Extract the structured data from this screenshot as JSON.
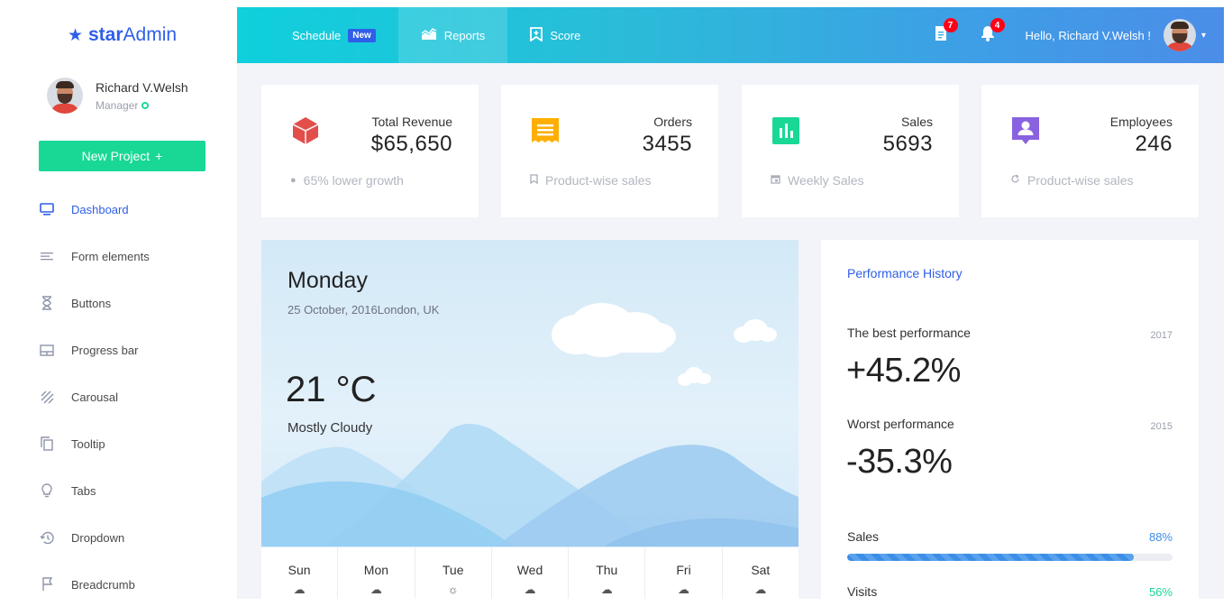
{
  "brand": {
    "prefix": "star",
    "suffix": "Admin"
  },
  "user": {
    "name": "Richard V.Welsh",
    "role": "Manager",
    "greeting": "Hello, Richard V.Welsh !"
  },
  "sidebar": {
    "new_project": "New Project",
    "items": [
      {
        "label": "Dashboard",
        "icon": "monitor-icon",
        "active": true
      },
      {
        "label": "Form elements",
        "icon": "lines-icon"
      },
      {
        "label": "Buttons",
        "icon": "hourglass-icon"
      },
      {
        "label": "Progress bar",
        "icon": "layout-icon"
      },
      {
        "label": "Carousal",
        "icon": "stripes-icon"
      },
      {
        "label": "Tooltip",
        "icon": "copy-icon"
      },
      {
        "label": "Tabs",
        "icon": "lightbulb-icon"
      },
      {
        "label": "Dropdown",
        "icon": "history-icon"
      },
      {
        "label": "Breadcrumb",
        "icon": "flag-icon"
      }
    ]
  },
  "topnav": {
    "items": [
      {
        "label": "Schedule",
        "badge": "New",
        "icon": ""
      },
      {
        "label": "Reports",
        "icon": "chart-icon"
      },
      {
        "label": "Score",
        "icon": "bookmark-icon"
      }
    ],
    "notifications": {
      "messages": "7",
      "alerts": "4"
    }
  },
  "stats": [
    {
      "label": "Total Revenue",
      "value": "$65,650",
      "foot": "65% lower growth",
      "color": "#e24f4b",
      "icon": "cube-icon",
      "foot_icon": "info-icon"
    },
    {
      "label": "Orders",
      "value": "3455",
      "foot": "Product-wise sales",
      "color": "#ffaf00",
      "icon": "receipt-icon",
      "foot_icon": "bookmark-icon"
    },
    {
      "label": "Sales",
      "value": "5693",
      "foot": "Weekly Sales",
      "color": "#19d895",
      "icon": "bar-chart-icon",
      "foot_icon": "calendar-icon"
    },
    {
      "label": "Employees",
      "value": "246",
      "foot": "Product-wise sales",
      "color": "#8862e0",
      "icon": "account-box-icon",
      "foot_icon": "reload-icon"
    }
  ],
  "weather": {
    "day": "Monday",
    "date": "25 October, 2016",
    "location": "London, UK",
    "temperature": "21 °C",
    "condition": "Mostly Cloudy",
    "forecast": [
      {
        "day": "Sun",
        "icon": "cloud-icon"
      },
      {
        "day": "Mon",
        "icon": "cloud-rain-icon"
      },
      {
        "day": "Tue",
        "icon": "sun-icon"
      },
      {
        "day": "Wed",
        "icon": "cloud-rain-icon"
      },
      {
        "day": "Thu",
        "icon": "cloud-rain-icon"
      },
      {
        "day": "Fri",
        "icon": "cloud-rain-icon"
      },
      {
        "day": "Sat",
        "icon": "cloud-icon"
      }
    ]
  },
  "performance": {
    "title": "Performance History",
    "best": {
      "label": "The best performance",
      "year": "2017",
      "value": "+45.2%"
    },
    "worst": {
      "label": "Worst performance",
      "year": "2015",
      "value": "-35.3%"
    },
    "progress": [
      {
        "label": "Sales",
        "percent_text": "88%",
        "fraction": 0.88,
        "color": "#3c8ee6"
      },
      {
        "label": "Visits",
        "percent_text": "56%",
        "fraction": 0.56,
        "color": "#19d895"
      }
    ]
  }
}
